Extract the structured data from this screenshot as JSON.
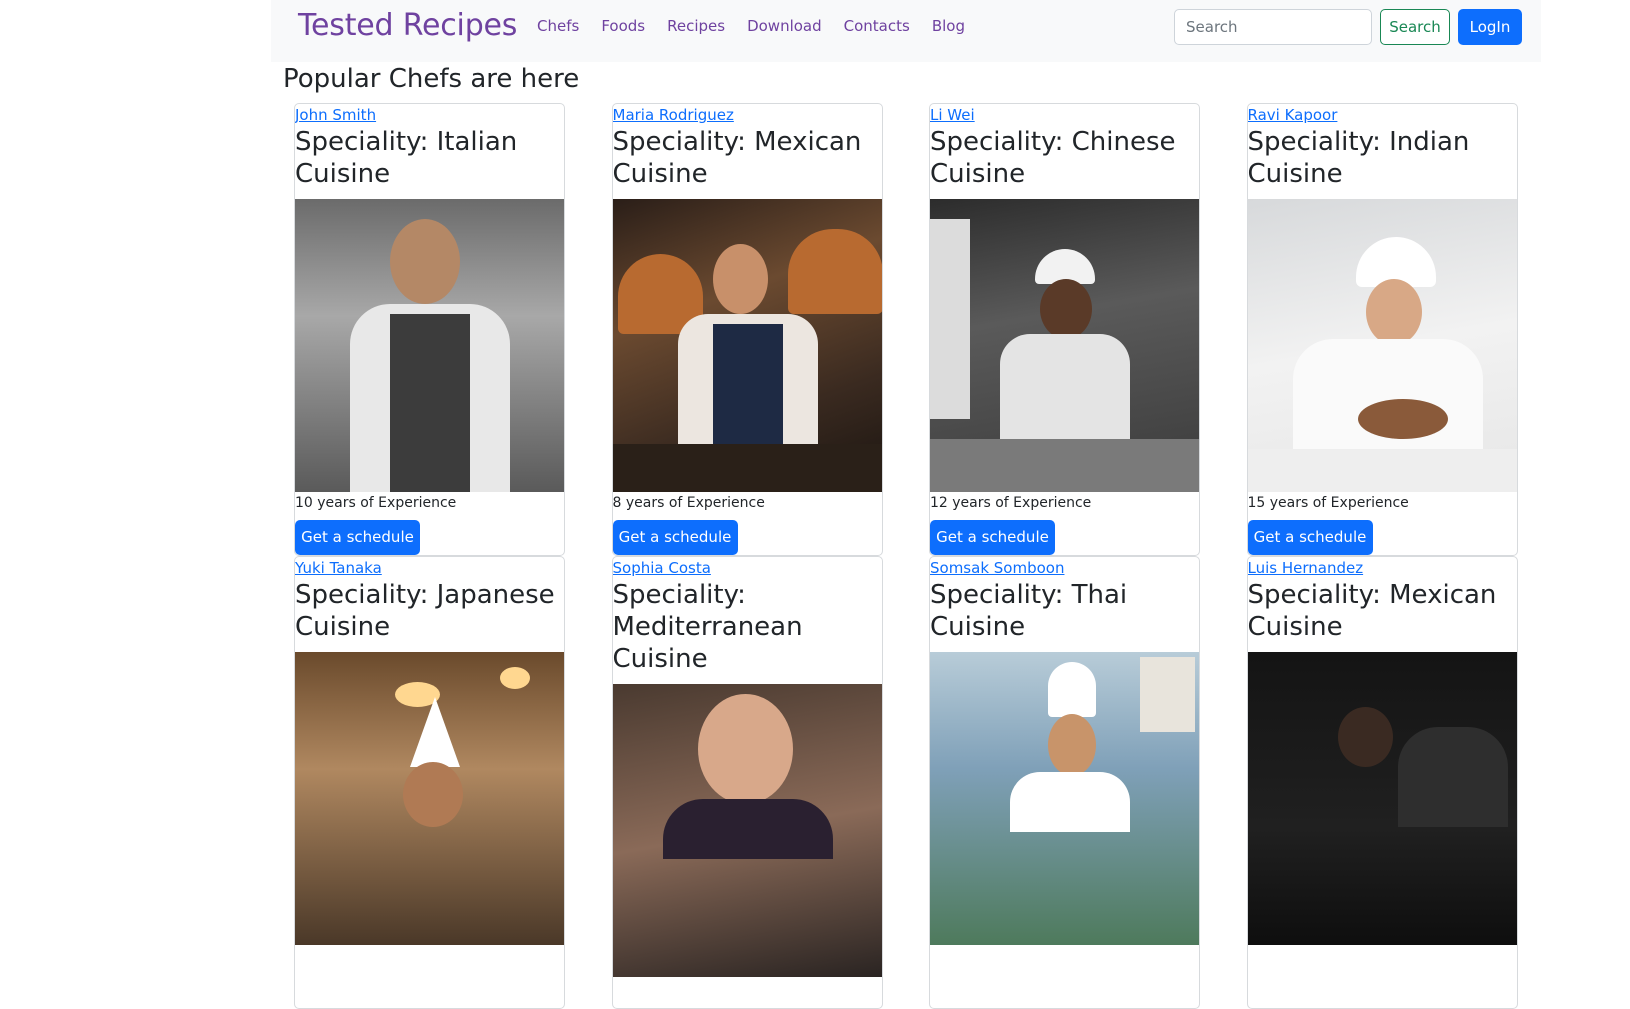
{
  "nav": {
    "brand": "Tested Recipes",
    "links": [
      "Chefs",
      "Foods",
      "Recipes",
      "Download",
      "Contacts",
      "Blog"
    ],
    "search_placeholder": "Search",
    "search_button": "Search",
    "login_button": "LogIn"
  },
  "page_title": "Popular Chefs are here",
  "chefs": [
    {
      "name": "John Smith",
      "speciality": "Speciality: Italian Cuisine",
      "experience": "10 years of Experience",
      "button": "Get a schedule"
    },
    {
      "name": "Maria Rodriguez",
      "speciality": "Speciality: Mexican Cuisine",
      "experience": "8 years of Experience",
      "button": "Get a schedule"
    },
    {
      "name": "Li Wei",
      "speciality": "Speciality: Chinese Cuisine",
      "experience": "12 years of Experience",
      "button": "Get a schedule"
    },
    {
      "name": "Ravi Kapoor",
      "speciality": "Speciality: Indian Cuisine",
      "experience": "15 years of Experience",
      "button": "Get a schedule"
    },
    {
      "name": "Yuki Tanaka",
      "speciality": "Speciality: Japanese Cuisine",
      "experience": "",
      "button": ""
    },
    {
      "name": "Sophia Costa",
      "speciality": "Speciality: Mediterranean Cuisine",
      "experience": "",
      "button": ""
    },
    {
      "name": "Somsak Somboon",
      "speciality": "Speciality: Thai Cuisine",
      "experience": "",
      "button": ""
    },
    {
      "name": "Luis Hernandez",
      "speciality": "Speciality: Mexican Cuisine",
      "experience": "",
      "button": ""
    }
  ]
}
